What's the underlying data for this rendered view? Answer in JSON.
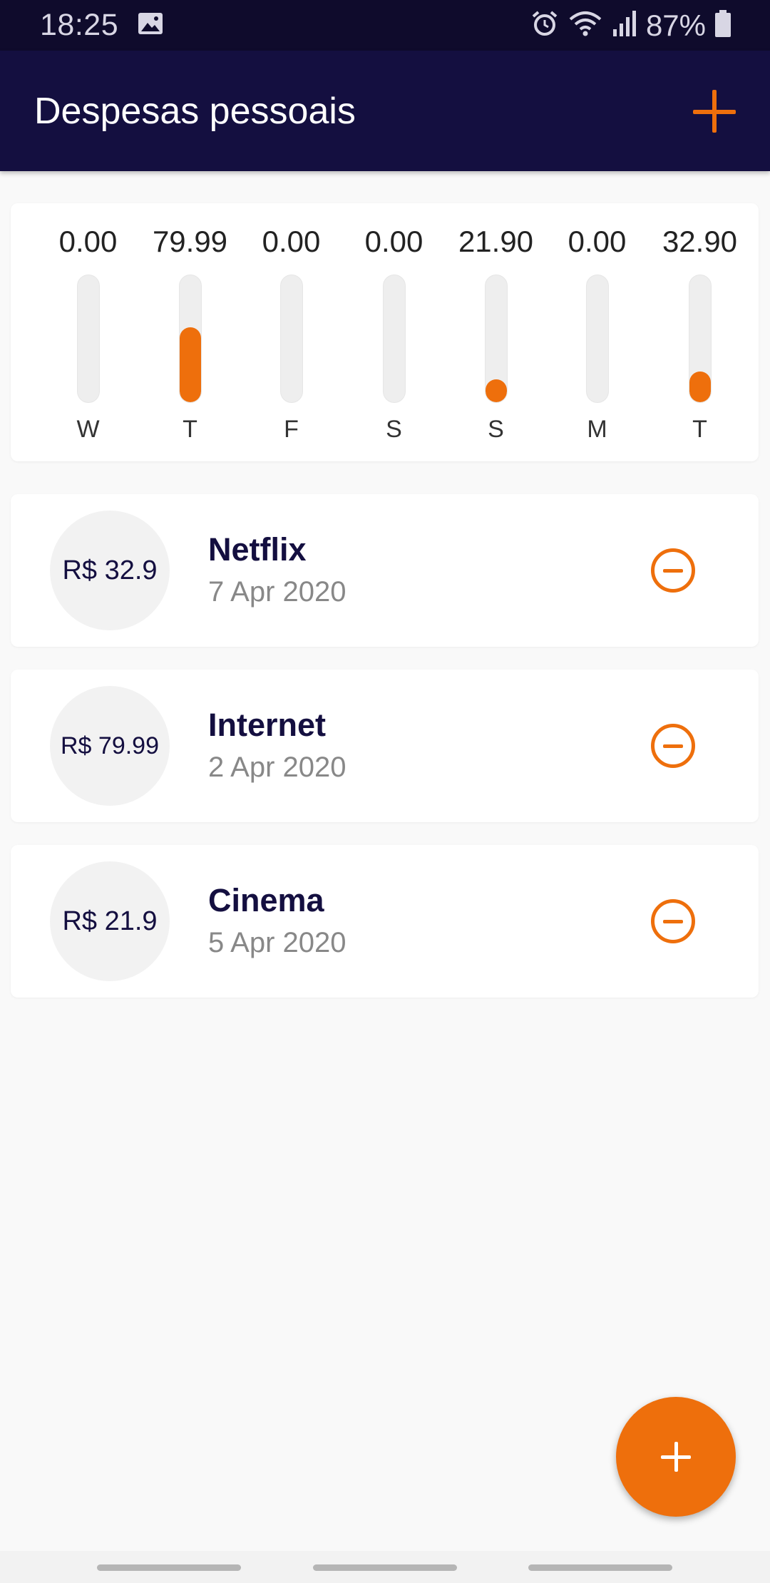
{
  "status_bar": {
    "time": "18:25",
    "battery": "87%",
    "icons": [
      "image-icon",
      "alarm-icon",
      "wifi-icon",
      "signal-icon",
      "battery-icon"
    ]
  },
  "app_bar": {
    "title": "Despesas pessoais",
    "add_icon": "plus-icon"
  },
  "weekly_chart": {
    "days": [
      {
        "label": "W",
        "value": "0.00",
        "fraction": 0.0
      },
      {
        "label": "T",
        "value": "79.99",
        "fraction": 0.5888
      },
      {
        "label": "F",
        "value": "0.00",
        "fraction": 0.0
      },
      {
        "label": "S",
        "value": "0.00",
        "fraction": 0.0
      },
      {
        "label": "S",
        "value": "21.90",
        "fraction": 0.1612
      },
      {
        "label": "M",
        "value": "0.00",
        "fraction": 0.0
      },
      {
        "label": "T",
        "value": "32.90",
        "fraction": 0.2422
      }
    ]
  },
  "expenses": [
    {
      "amount": "R$ 32.9",
      "title": "Netflix",
      "date": "7 Apr 2020"
    },
    {
      "amount": "R$ 79.99",
      "title": "Internet",
      "date": "2 Apr 2020"
    },
    {
      "amount": "R$ 21.9",
      "title": "Cinema",
      "date": "5 Apr 2020"
    }
  ],
  "colors": {
    "primary": "#140f40",
    "accent": "#ee6f0c",
    "background": "#f9f9f9"
  }
}
